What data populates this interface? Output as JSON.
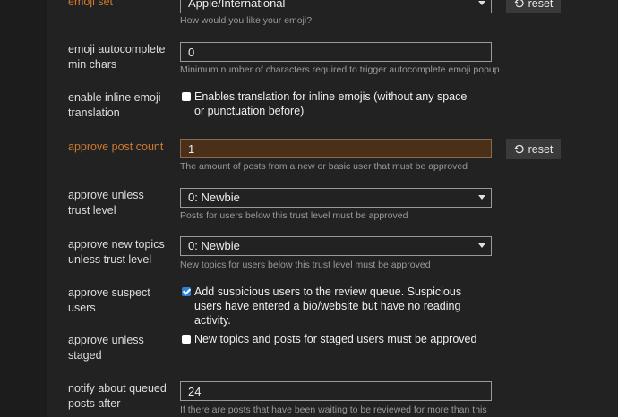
{
  "settings": [
    {
      "label": "emoji set",
      "value": "Apple/International",
      "desc": "How would you like your emoji?",
      "reset": "reset"
    },
    {
      "label": "emoji autocomplete min chars",
      "value": "0",
      "desc": "Minimum number of characters required to trigger autocomplete emoji popup"
    },
    {
      "label": "enable inline emoji translation",
      "checkbox_text": "Enables translation for inline emojis (without any space or punctuation before)",
      "checked": false
    },
    {
      "label": "approve post count",
      "value": "1",
      "desc": "The amount of posts from a new or basic user that must be approved",
      "reset": "reset"
    },
    {
      "label": "approve unless trust level",
      "value": "0: Newbie",
      "desc": "Posts for users below this trust level must be approved"
    },
    {
      "label": "approve new topics unless trust level",
      "value": "0: Newbie",
      "desc": "New topics for users below this trust level must be approved"
    },
    {
      "label": "approve suspect users",
      "checkbox_text": "Add suspicious users to the review queue. Suspicious users have entered a bio/website but have no reading activity.",
      "checked": true
    },
    {
      "label": "approve unless staged",
      "checkbox_text": "New topics and posts for staged users must be approved",
      "checked": false
    },
    {
      "label": "notify about queued posts after",
      "value": "24",
      "desc": "If there are posts that have been waiting to be reviewed for more than this"
    }
  ],
  "colors": {
    "changed_label": "#cf7b2f",
    "changed_input_bg": "#4a3018",
    "checkbox_on": "#2f7fd8"
  },
  "icons": {
    "reset": "undo-icon",
    "dropdown": "caret-down-icon"
  }
}
